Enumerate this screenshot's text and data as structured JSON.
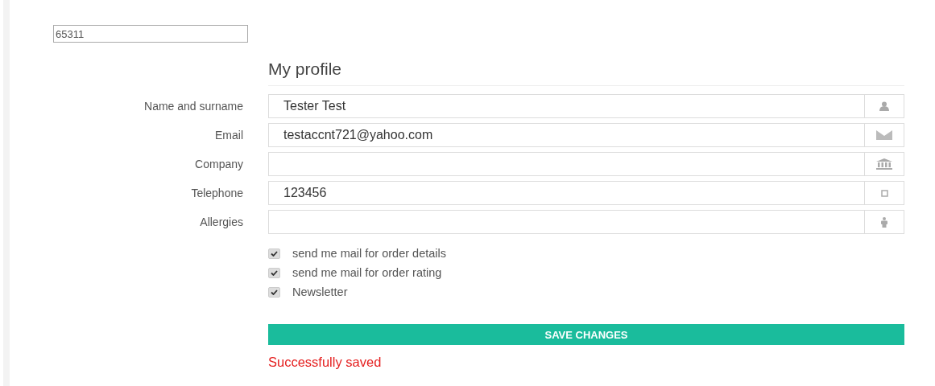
{
  "code_field": {
    "value": "65311"
  },
  "title": "My profile",
  "fields": [
    {
      "label": "Name and surname",
      "value": "Tester Test",
      "kind": "person"
    },
    {
      "label": "Email",
      "value": "testaccnt721@yahoo.com",
      "kind": "mail"
    },
    {
      "label": "Company",
      "kind": "bank"
    },
    {
      "label": "Telephone",
      "value": "123456",
      "kind": "phone"
    },
    {
      "label": "Allergies",
      "kind": "figure"
    }
  ],
  "checkboxes": [
    {
      "label": "send me mail for order details",
      "checked": true
    },
    {
      "label": "send me mail for order rating",
      "checked": true
    },
    {
      "label": "Newsletter",
      "checked": true
    }
  ],
  "save_button": "SAVE CHANGES",
  "status": "Successfully saved"
}
